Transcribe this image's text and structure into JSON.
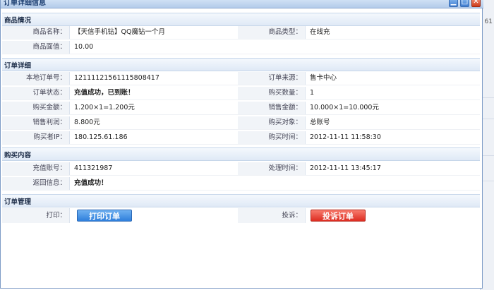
{
  "window": {
    "title": "订单详细信息"
  },
  "background": {
    "edge_number": "61"
  },
  "sections": {
    "product": "商品情况",
    "order": "订单详细",
    "purchase": "购买内容",
    "manage": "订单管理"
  },
  "product": {
    "name_label": "商品名称：",
    "name_value": "【天信手机钻】QQ魔钻一个月",
    "type_label": "商品类型：",
    "type_value": "在线充",
    "face_label": "商品面值：",
    "face_value": "10.00"
  },
  "order": {
    "local_id_label": "本地订单号：",
    "local_id_value": "12111121561115808417",
    "source_label": "订单来源：",
    "source_value": "售卡中心",
    "status_label": "订单状态：",
    "status_value": "充值成功，已到账！",
    "qty_label": "购买数量：",
    "qty_value": "1",
    "buy_amount_label": "购买金额：",
    "buy_amount_value": "1.200×1=1.200元",
    "sale_amount_label": "销售金额：",
    "sale_amount_value": "10.000×1=10.000元",
    "profit_label": "销售利润：",
    "profit_value": "8.800元",
    "target_label": "购买对象：",
    "target_value": "总账号",
    "ip_label": "购买者IP：",
    "ip_value": "180.125.61.186",
    "time_label": "购买时间：",
    "time_value": "2012-11-11 11:58:30"
  },
  "purchase": {
    "account_label": "充值账号：",
    "account_value": "411321987",
    "process_label": "处理时间：",
    "process_value": "2012-11-11 13:45:17",
    "return_label": "返回信息：",
    "return_value": "充值成功！"
  },
  "manage": {
    "print_label": "打印：",
    "print_button": "打印订单",
    "complain_label": "投诉：",
    "complain_button": "投诉订单"
  },
  "colors": {
    "success_green": "#1a8a1a",
    "info_blue": "#1a2fd0",
    "print_btn": "#2f7fdc",
    "complain_btn": "#dd2d22"
  }
}
